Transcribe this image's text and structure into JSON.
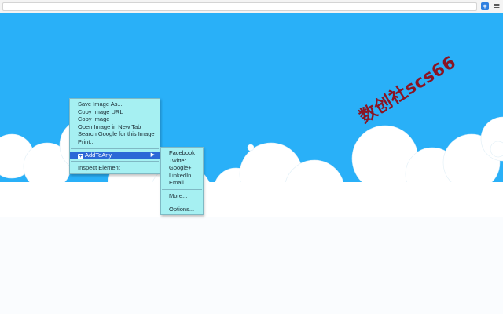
{
  "toolbar": {
    "extension_icon": "addtoany-plus-icon",
    "extension_glyph": "+",
    "menu_icon": "hamburger-menu-icon",
    "menu_glyph": "≡"
  },
  "watermark": {
    "text": "数创社scs66"
  },
  "context_menu": {
    "items": [
      "Save Image As...",
      "Copy Image URL",
      "Copy Image",
      "Open Image in New Tab",
      "Search Google for this Image",
      "Print..."
    ],
    "addtoany": {
      "label": "AddToAny",
      "icon_glyph": "+",
      "arrow": "▶"
    },
    "inspect": "Inspect Element"
  },
  "submenu": {
    "services": [
      "Facebook",
      "Twitter",
      "Google+",
      "LinkedIn",
      "Email"
    ],
    "more": "More...",
    "options": "Options..."
  },
  "colors": {
    "sky": "#29b0f8",
    "cloud": "#ffffff",
    "menu_bg": "#a6f0f2",
    "menu_highlight": "#2b68d6",
    "watermark": "#8a1423"
  }
}
